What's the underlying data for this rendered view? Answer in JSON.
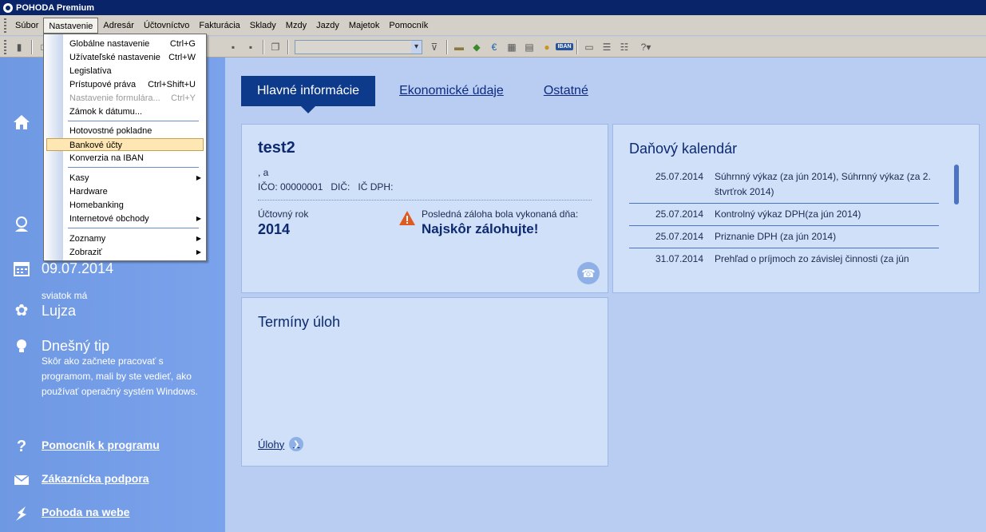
{
  "window": {
    "title": "POHODA Premium"
  },
  "menubar": {
    "items": [
      "Súbor",
      "Nastavenie",
      "Adresár",
      "Účtovníctvo",
      "Fakturácia",
      "Sklady",
      "Mzdy",
      "Jazdy",
      "Majetok",
      "Pomocník"
    ]
  },
  "dropdown": {
    "items": [
      {
        "label": "Globálne nastavenie",
        "shortcut": "Ctrl+G"
      },
      {
        "label": "Užívateľské nastavenie",
        "shortcut": "Ctrl+W"
      },
      {
        "label": "Legislatíva",
        "shortcut": ""
      },
      {
        "label": "Prístupové práva",
        "shortcut": "Ctrl+Shift+U"
      },
      {
        "label": "Nastavenie formulára...",
        "shortcut": "Ctrl+Y"
      },
      {
        "label": "Zámok k dátumu...",
        "shortcut": ""
      },
      {
        "label": "Hotovostné pokladne",
        "shortcut": ""
      },
      {
        "label": "Bankové účty",
        "shortcut": ""
      },
      {
        "label": "Konverzia na IBAN",
        "shortcut": ""
      },
      {
        "label": "Kasy",
        "shortcut": ""
      },
      {
        "label": "Hardware",
        "shortcut": ""
      },
      {
        "label": "Homebanking",
        "shortcut": ""
      },
      {
        "label": "Internetové obchody",
        "shortcut": ""
      },
      {
        "label": "Zoznamy",
        "shortcut": ""
      },
      {
        "label": "Zobraziť",
        "shortcut": ""
      }
    ]
  },
  "toolbar": {
    "iban_label": "IBAN"
  },
  "sidebar": {
    "date": "09.07.2014",
    "name_day_label": "sviatok má",
    "name_day": "Lujza",
    "tip_title": "Dnešný tip",
    "tip_text": "Skôr ako začnete pracovať s programom, mali by ste vedieť, ako používať operačný systém Windows.",
    "links": [
      "Pomocník k programu",
      "Zákaznícka podpora",
      "Pohoda na webe"
    ]
  },
  "tabs": [
    "Hlavné informácie",
    "Ekonomické údaje",
    "Ostatné"
  ],
  "company": {
    "name": "test2",
    "address": ", a",
    "ids": "IČO: 00000001   DIČ:   IČ DPH:",
    "fiscal_year_label": "Účtovný rok",
    "fiscal_year": "2014",
    "backup_label": "Posledná záloha bola vykonaná dňa:",
    "backup_value": "Najskôr zálohujte!"
  },
  "tax_calendar": {
    "title": "Daňový kalendár",
    "rows": [
      {
        "date": "25.07.2014",
        "desc": "Súhrnný výkaz (za jún 2014), Súhrnný výkaz (za 2. štvrťrok 2014)"
      },
      {
        "date": "25.07.2014",
        "desc": "Kontrolný výkaz DPH(za jún 2014)"
      },
      {
        "date": "25.07.2014",
        "desc": "Priznanie DPH (za jún 2014)"
      },
      {
        "date": "31.07.2014",
        "desc": "Prehľad o príjmoch zo závislej činnosti (za jún"
      }
    ]
  },
  "tasks": {
    "title": "Termíny úloh",
    "link": "Úlohy"
  }
}
